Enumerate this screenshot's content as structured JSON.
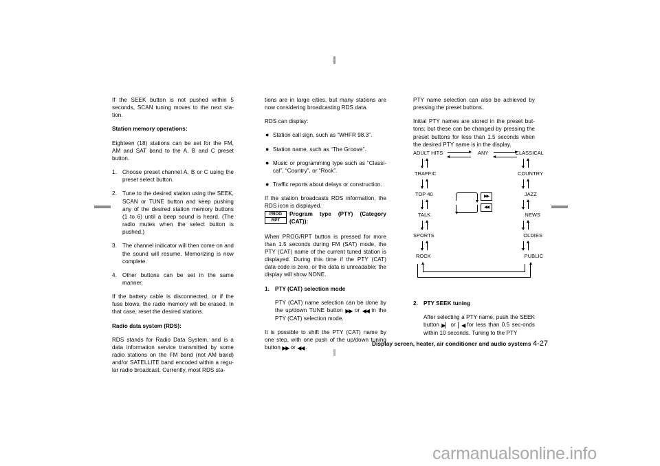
{
  "document": {
    "title": "Nissan Owner's Manual - Display screen, heater, air conditioner and audio systems",
    "footer_text": "Display screen, heater, air conditioner and audio systems",
    "page_number": "4-27",
    "watermark": "carmanualsonline.info"
  },
  "column1": {
    "p1": "If the SEEK button is not pushed within 5 seconds, SCAN tuning moves to the next sta-tion.",
    "h1": "Station memory operations:",
    "p2": "Eighteen (18) stations can be set for the FM, AM and SAT band to the A, B and C preset button.",
    "item1_num": "1.",
    "item1": "Choose preset channel A, B or C using the preset select button.",
    "item2_num": "2.",
    "item2": "Tune to the desired station using the SEEK, SCAN or TUNE button and keep pushing any of the desired station memory buttons (1 to 6) until a beep sound is heard. (The radio mutes when the select button is pushed.)",
    "item3_num": "3.",
    "item3": "The channel indicator will then come on and the sound will resume. Memorizing is now complete.",
    "item4_num": "4.",
    "item4": "Other buttons can be set in the same manner.",
    "p3": "If the battery cable is disconnected, or if the fuse blows, the radio memory will be erased. In that case, reset the desired stations.",
    "h2": "Radio data system (RDS):",
    "p4": "RDS stands for Radio Data System, and is a data information service transmitted by some radio stations on the FM band (not AM band) and/or SATELLITE band encoded within a regu-lar radio broadcast. Currently, most RDS sta-"
  },
  "column2": {
    "p1": "tions are in large cities, but many stations are now considering broadcasting RDS data.",
    "p2": "RDS can display:",
    "bullet1": "Station call sign, such as “WHFR 98.3”.",
    "bullet2": "Station name, such as “The Groove”.",
    "bullet3": "Music or programming type such as “Classi-cal”, “Country”, or “Rock”.",
    "bullet4": "Traffic reports about delays or construction.",
    "p3": "If the station broadcasts RDS information, the RDS icon is displayed.",
    "icon_line1": "PROG",
    "icon_line2": "RPT",
    "h1": "Program type (PTY) (Category (CAT)):",
    "p4": "When PROG/RPT button is pressed for more than 1.5 seconds during FM (SAT) mode, the PTY (CAT) name of the current tuned station is displayed. During this time if the PTY (CAT) data code is zero, or the data is unreadable; the display will show NONE.",
    "h2_num": "1.",
    "h2": "PTY (CAT) selection mode",
    "p5_a": "PTY (CAT) name selection can be done by the up/down TUNE button",
    "p5_b": "or",
    "p5_c": "in the PTY (CAT) selection mode.",
    "p6_a": "It is possible to shift the PTY (CAT) name by one step, with one push of the up/down tuning button",
    "p6_b": "or",
    "p6_c": "."
  },
  "column3": {
    "p1": "PTY name selection can also be achieved by pressing the preset buttons.",
    "p2": "Initial PTY names are stored in the preset but-tons; but these can be changed by pressing the preset buttons for less than 1.5 seconds when the desired PTY name is in the display.",
    "h1_num": "2.",
    "h1": "PTY SEEK tuning",
    "p3_a": "After selecting a PTY name, push the SEEK button",
    "p3_b": "or",
    "p3_c": "for less than 0.5 sec-onds within 10 seconds. Tuning to the PTY"
  },
  "pty_diagram": {
    "left_column": [
      "ADULT HITS",
      "TRAFFIC",
      "TOP 40",
      "TALK",
      "SPORTS",
      "ROCK"
    ],
    "center_top": "ANY",
    "right_column": [
      "CLASSICAL",
      "COUNTRY",
      "JAZZ",
      "NEWS",
      "OLDIES",
      "PUBLIC"
    ],
    "center_key_up": "▶▶",
    "center_key_down": "◀◀"
  }
}
